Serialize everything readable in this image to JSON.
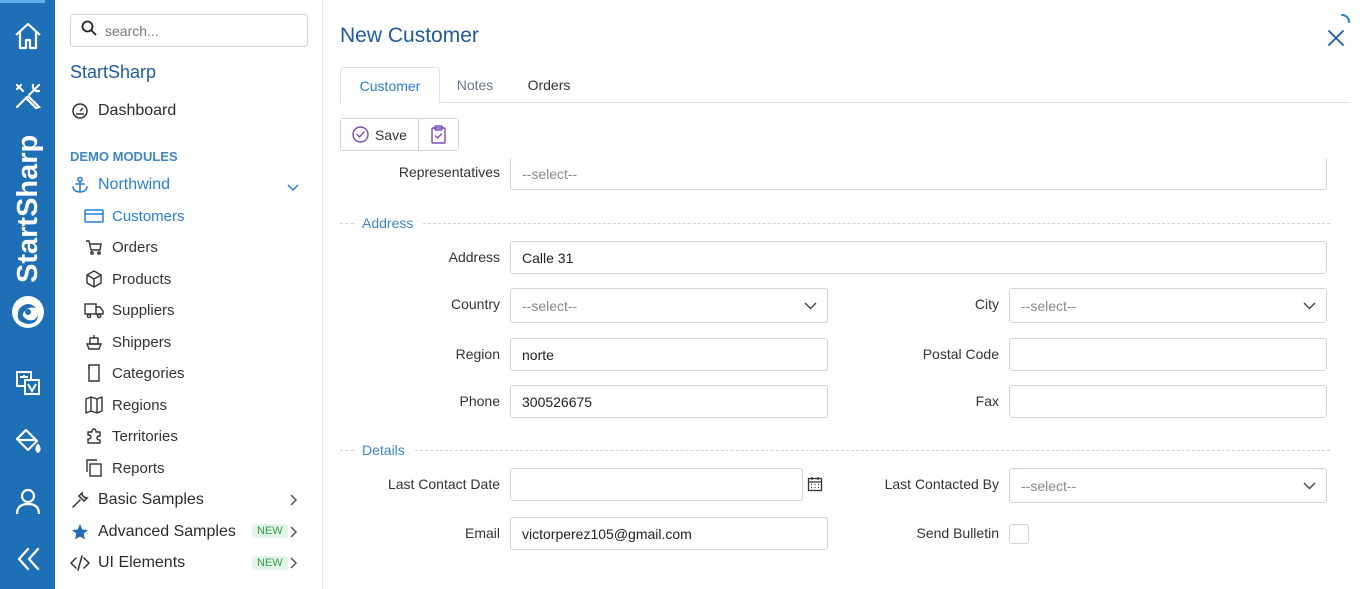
{
  "rail": {
    "brand_text": "StartSharp"
  },
  "sidebar": {
    "search_placeholder": "search...",
    "brand": "StartSharp",
    "dashboard": "Dashboard",
    "section": "DEMO MODULES",
    "northwind": "Northwind",
    "items": [
      "Customers",
      "Orders",
      "Products",
      "Suppliers",
      "Shippers",
      "Categories",
      "Regions",
      "Territories",
      "Reports"
    ],
    "basic_samples": "Basic Samples",
    "advanced_samples": "Advanced Samples",
    "ui_elements": "UI Elements",
    "new_badge": "NEW"
  },
  "dialog": {
    "title": "New Customer",
    "tabs": [
      "Customer",
      "Notes",
      "Orders"
    ],
    "save_label": "Save"
  },
  "form": {
    "representatives_label": "Representatives",
    "representatives_placeholder": "--select--",
    "address_section": "Address",
    "address_label": "Address",
    "address_value": "Calle 31",
    "country_label": "Country",
    "country_placeholder": "--select--",
    "city_label": "City",
    "city_placeholder": "--select--",
    "region_label": "Region",
    "region_value": "norte",
    "postal_label": "Postal Code",
    "postal_value": "",
    "phone_label": "Phone",
    "phone_value": "300526675",
    "fax_label": "Fax",
    "fax_value": "",
    "details_section": "Details",
    "last_contact_date_label": "Last Contact Date",
    "last_contact_date_value": "",
    "last_contacted_by_label": "Last Contacted By",
    "last_contacted_by_placeholder": "--select--",
    "email_label": "Email",
    "email_value": "victorperez105@gmail.com",
    "send_bulletin_label": "Send Bulletin",
    "send_bulletin_checked": false
  },
  "colors": {
    "rail": "#1f6fb6",
    "accent": "#2a7fd4",
    "title": "#1d5b9a"
  }
}
